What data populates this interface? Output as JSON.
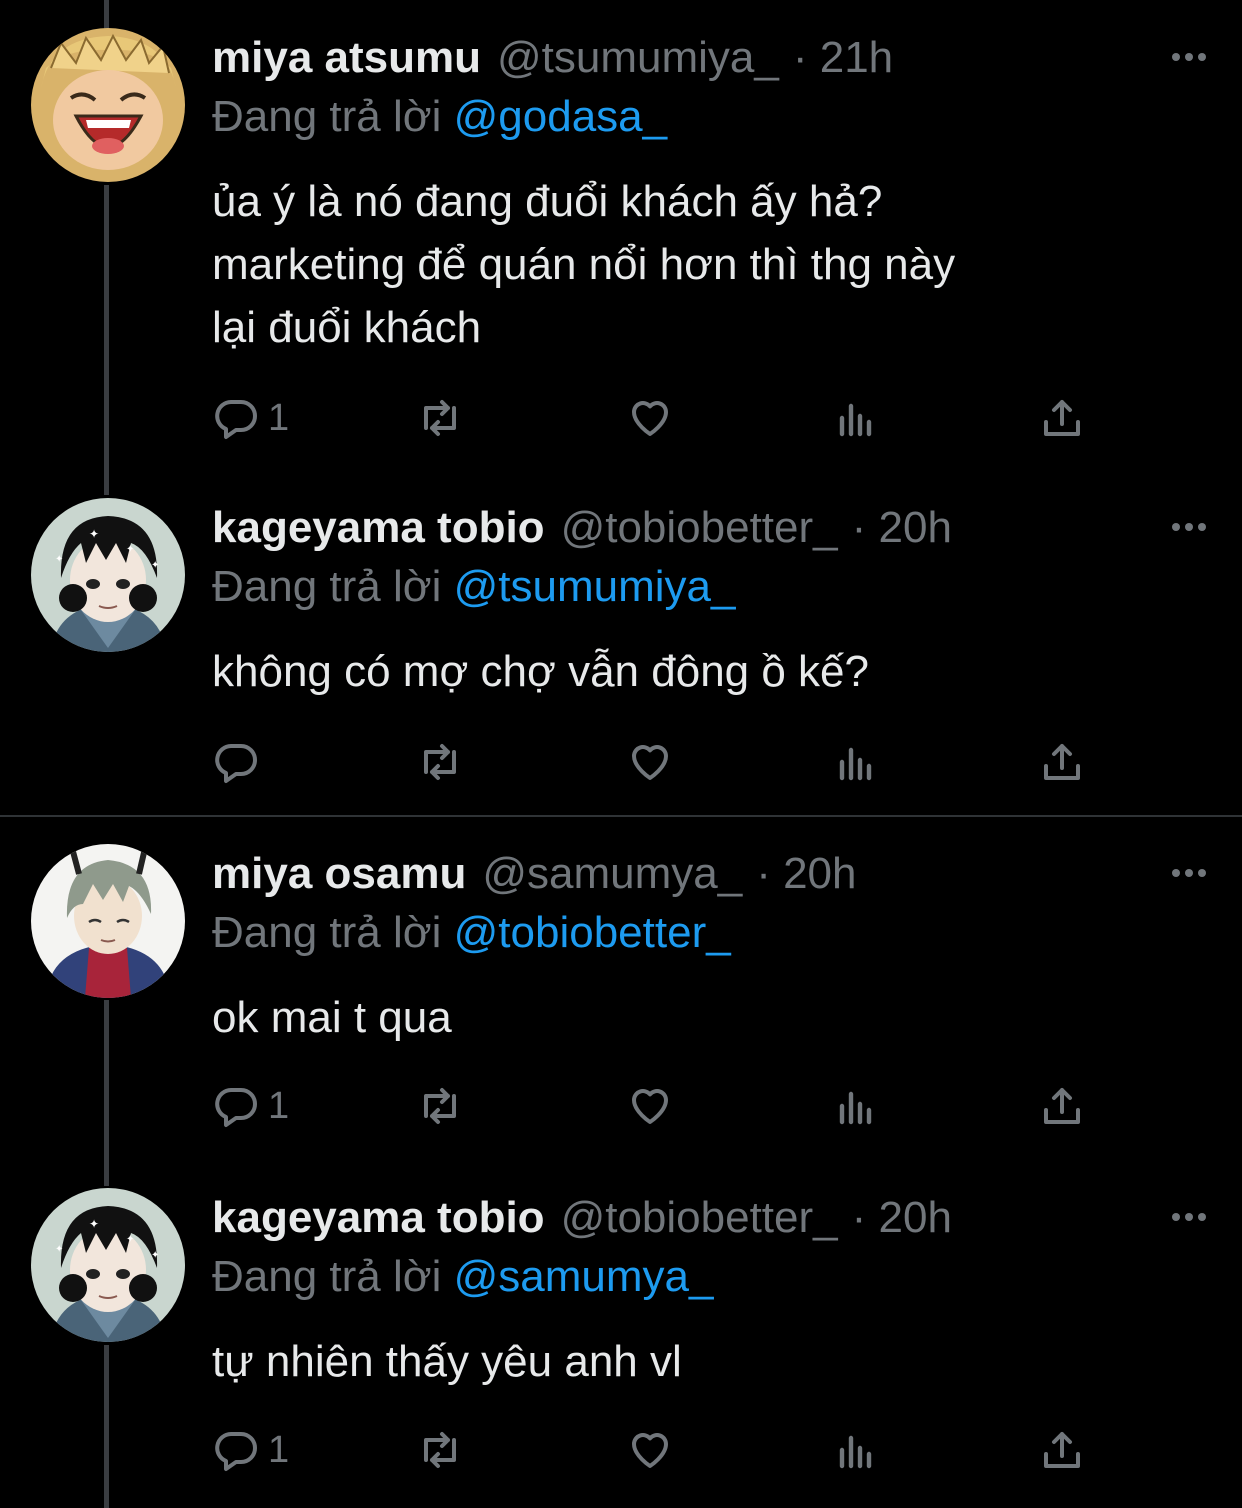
{
  "labels": {
    "replying_to": "Đang trả lời"
  },
  "colors": {
    "background": "#000000",
    "link": "#1d9bf0",
    "muted": "#71767b",
    "text": "#e7e9ea"
  },
  "tweets": [
    {
      "name": "miya atsumu",
      "handle": "@tsumumiya_",
      "time": "· 21h",
      "reply_to": "@godasa_",
      "lines": [
        "ủa ý là nó đang đuổi khách ấy hả?",
        "marketing để quán nổi hơn thì thg này",
        "lại đuổi khách"
      ],
      "reply_count": "1",
      "avatar": "laughing-blond-avatar"
    },
    {
      "name": "kageyama tobio",
      "handle": "@tobiobetter_",
      "time": "· 20h",
      "reply_to": "@tsumumiya_",
      "lines": [
        "không có mợ chợ vẫn đông ồ kế?"
      ],
      "reply_count": "",
      "avatar": "dark-hair-scarf-avatar"
    },
    {
      "name": "miya osamu",
      "handle": "@samumya_",
      "time": "· 20h",
      "reply_to": "@tobiobetter_",
      "lines": [
        "ok mai t qua"
      ],
      "reply_count": "1",
      "avatar": "grey-hair-red-jacket-avatar"
    },
    {
      "name": "kageyama tobio",
      "handle": "@tobiobetter_",
      "time": "· 20h",
      "reply_to": "@samumya_",
      "lines": [
        "tự nhiên thấy yêu anh vl"
      ],
      "reply_count": "1",
      "avatar": "dark-hair-scarf-avatar"
    }
  ]
}
